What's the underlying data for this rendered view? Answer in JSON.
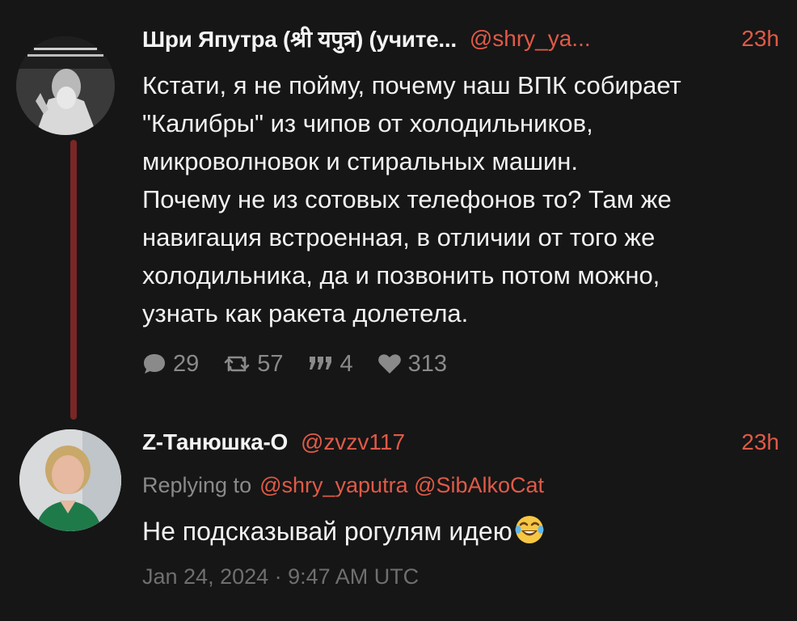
{
  "tweet1": {
    "author_name": "Шри Япутра (श्री यपुत्र) (учите...",
    "handle": "@shry_ya...",
    "time": "23h",
    "text": "Кстати, я не пойму, почему наш ВПК собирает\n\"Калибры\" из чипов от холодильников,\nмикроволновок и стиральных машин.\nПочему не из сотовых телефонов то? Там же\nнавигация встроенная, в отличии от того же\nхолодильника, да и позвонить потом можно,\nузнать как ракета долетела.",
    "stats": {
      "replies": "29",
      "retweets": "57",
      "quotes": "4",
      "likes": "313"
    }
  },
  "tweet2": {
    "author_name": "Z-Танюшка-O",
    "handle": "@zvzv117",
    "time": "23h",
    "replying_to_label": "Replying to",
    "replying_to": "@shry_yaputra @SibAlkoCat",
    "text": "Не подсказывай рогулям идею",
    "timestamp": "Jan 24, 2024 · 9:47 AM UTC"
  },
  "colors": {
    "background": "#161616",
    "accent": "#e05a47",
    "muted": "#8a8a8a",
    "thread_line": "#7a2626"
  },
  "icons": [
    "reply-icon",
    "retweet-icon",
    "quote-icon",
    "heart-icon",
    "laughing-emoji-icon"
  ]
}
